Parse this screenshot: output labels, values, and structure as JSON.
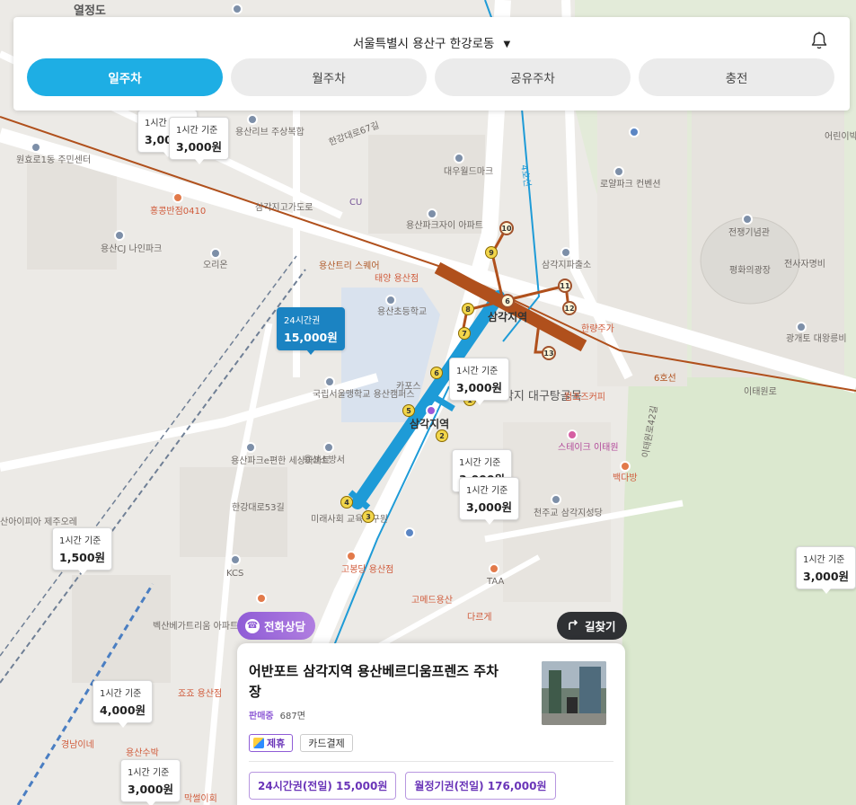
{
  "header": {
    "location": "서울특별시 용산구 한강로동",
    "tabs": [
      {
        "label": "일주차",
        "active": true
      },
      {
        "label": "월주차",
        "active": false
      },
      {
        "label": "공유주차",
        "active": false
      },
      {
        "label": "충전",
        "active": false
      }
    ],
    "notification_icon": "bell-icon"
  },
  "map": {
    "labels": [
      "열정도",
      "원효로1동 주민센터",
      "홍콩반점0410",
      "용산CJ 나인파크",
      "오리온",
      "용산리브 주상복합",
      "삼각지고가도로",
      "대우월드마크",
      "용산파크자이 아파트",
      "CU",
      "로얄파크 컨벤션",
      "전쟁기념관",
      "평화의광장",
      "전사자명비",
      "광개토 대왕릉비",
      "어린이박",
      "삼각지파출소",
      "한량주가",
      "용산트리 스퀘어",
      "태양 용산점",
      "용산초등학교",
      "삼각지역",
      "카포스",
      "국립서울맹학교 용산캠퍼스",
      "삼각지 대구탕골목",
      "컴포즈커피",
      "스테이크 이태원",
      "백다방",
      "용산파크e편한 세상아파트",
      "용산소방서",
      "미래사회 교육연구원",
      "천주교 삼각지성당",
      "산아이피아 제주오레",
      "KCS",
      "고봉당 용산점",
      "고메드용산",
      "TAA",
      "다르게",
      "벡산베가트리움 아파트",
      "경남이네",
      "죠죠 용산점",
      "용산수박",
      "막썰이회",
      "한강대로53길",
      "한강대로67길",
      "이태원로",
      "이태원로42길",
      "6호선",
      "4호선"
    ],
    "metro_exits": [
      "1",
      "2",
      "3",
      "4",
      "5",
      "6",
      "7",
      "8",
      "9",
      "10",
      "11",
      "12",
      "13",
      "6"
    ],
    "price_markers": [
      {
        "top": "1시간 기준",
        "price": "3,000원"
      },
      {
        "top": "1시간 기준",
        "price": "3,000원"
      },
      {
        "top": "24시간권",
        "price": "15,000원",
        "active": true
      },
      {
        "top": "1시간 기준",
        "price": "3,000원"
      },
      {
        "top": "1시간 기준",
        "price": "3,000원"
      },
      {
        "top": "1시간 기준",
        "price": "3,000원"
      },
      {
        "top": "1시간 기준",
        "price": "1,500원"
      },
      {
        "top": "1시간 기준",
        "price": "3,000원"
      },
      {
        "top": "1시간 기준",
        "price": "4,000원"
      },
      {
        "top": "1시간 기준",
        "price": "3,000원"
      }
    ]
  },
  "actions": {
    "call_label": "전화상담",
    "route_label": "길찾기"
  },
  "card": {
    "title": "어반포트 삼각지역 용산베르디움프렌즈 주차장",
    "status": "판매중",
    "count": "687면",
    "badges": [
      "제휴",
      "카드결제"
    ],
    "tickets": [
      "24시간권(전일) 15,000원",
      "월정기권(전일) 176,000원"
    ]
  },
  "colors": {
    "accent": "#1eaee4",
    "purple": "#8f5cd6",
    "line4": "#1e9bd7",
    "line6": "#b0501c"
  }
}
